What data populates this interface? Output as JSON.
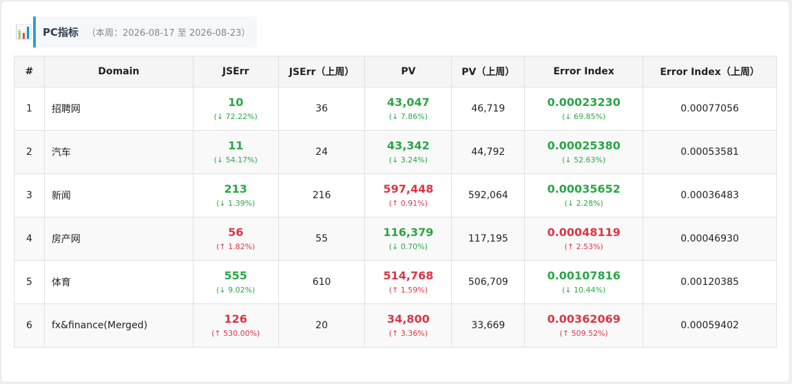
{
  "header": {
    "icon": "chart-icon",
    "title": "PC指标",
    "date_range": "（本周：2026-08-17 至 2026-08-23）"
  },
  "colors": {
    "good": "#28a745",
    "bad": "#dc3545",
    "accent": "#3498db"
  },
  "table": {
    "columns": [
      "#",
      "Domain",
      "JSErr",
      "JSErr（上周）",
      "PV",
      "PV（上周）",
      "Error Index",
      "Error Index（上周）"
    ],
    "rows": [
      {
        "idx": "1",
        "domain": "招聘网",
        "jserr": "10",
        "jserr_chg": "(↓ 72.22%)",
        "jserr_dir": "good",
        "jserr_prev": "36",
        "pv": "43,047",
        "pv_chg": "(↓ 7.86%)",
        "pv_dir": "good",
        "pv_prev": "46,719",
        "ei": "0.00023230",
        "ei_chg": "(↓ 69.85%)",
        "ei_dir": "good",
        "ei_prev": "0.00077056"
      },
      {
        "idx": "2",
        "domain": "汽车",
        "jserr": "11",
        "jserr_chg": "(↓ 54.17%)",
        "jserr_dir": "good",
        "jserr_prev": "24",
        "pv": "43,342",
        "pv_chg": "(↓ 3.24%)",
        "pv_dir": "good",
        "pv_prev": "44,792",
        "ei": "0.00025380",
        "ei_chg": "(↓ 52.63%)",
        "ei_dir": "good",
        "ei_prev": "0.00053581"
      },
      {
        "idx": "3",
        "domain": "新闻",
        "jserr": "213",
        "jserr_chg": "(↓ 1.39%)",
        "jserr_dir": "good",
        "jserr_prev": "216",
        "pv": "597,448",
        "pv_chg": "(↑ 0.91%)",
        "pv_dir": "bad",
        "pv_prev": "592,064",
        "ei": "0.00035652",
        "ei_chg": "(↓ 2.28%)",
        "ei_dir": "good",
        "ei_prev": "0.00036483"
      },
      {
        "idx": "4",
        "domain": "房产网",
        "jserr": "56",
        "jserr_chg": "(↑ 1.82%)",
        "jserr_dir": "bad",
        "jserr_prev": "55",
        "pv": "116,379",
        "pv_chg": "(↓ 0.70%)",
        "pv_dir": "good",
        "pv_prev": "117,195",
        "ei": "0.00048119",
        "ei_chg": "(↑ 2.53%)",
        "ei_dir": "bad",
        "ei_prev": "0.00046930"
      },
      {
        "idx": "5",
        "domain": "体育",
        "jserr": "555",
        "jserr_chg": "(↓ 9.02%)",
        "jserr_dir": "good",
        "jserr_prev": "610",
        "pv": "514,768",
        "pv_chg": "(↑ 1.59%)",
        "pv_dir": "bad",
        "pv_prev": "506,709",
        "ei": "0.00107816",
        "ei_chg": "(↓ 10.44%)",
        "ei_dir": "good",
        "ei_prev": "0.00120385"
      },
      {
        "idx": "6",
        "domain": "fx&finance(Merged)",
        "jserr": "126",
        "jserr_chg": "(↑ 530.00%)",
        "jserr_dir": "bad",
        "jserr_prev": "20",
        "pv": "34,800",
        "pv_chg": "(↑ 3.36%)",
        "pv_dir": "bad",
        "pv_prev": "33,669",
        "ei": "0.00362069",
        "ei_chg": "(↑ 509.52%)",
        "ei_dir": "bad",
        "ei_prev": "0.00059402"
      }
    ]
  }
}
